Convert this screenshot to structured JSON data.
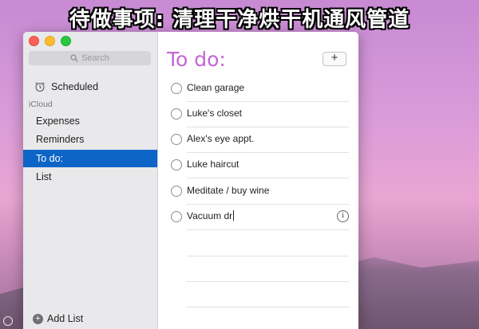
{
  "caption": "待做事项: 清理干净烘干机通风管道",
  "sidebar": {
    "search_placeholder": "Search",
    "scheduled_label": "Scheduled",
    "group_label": "iCloud",
    "lists": [
      "Expenses",
      "Reminders",
      "To do:",
      "List"
    ],
    "selected_list": "To do:",
    "add_list_label": "Add List"
  },
  "main": {
    "title": "To do:",
    "add_button": "+",
    "tasks": [
      "Clean garage",
      "Luke's closet",
      "Alex's eye appt.",
      "Luke haircut",
      "Meditate / buy wine",
      "Vacuum dr"
    ]
  },
  "colors": {
    "title": "#c366d6",
    "selection": "#0d65c8"
  },
  "icons": {
    "search": "search-icon",
    "scheduled": "alarm-clock-icon",
    "info": "info-icon"
  }
}
